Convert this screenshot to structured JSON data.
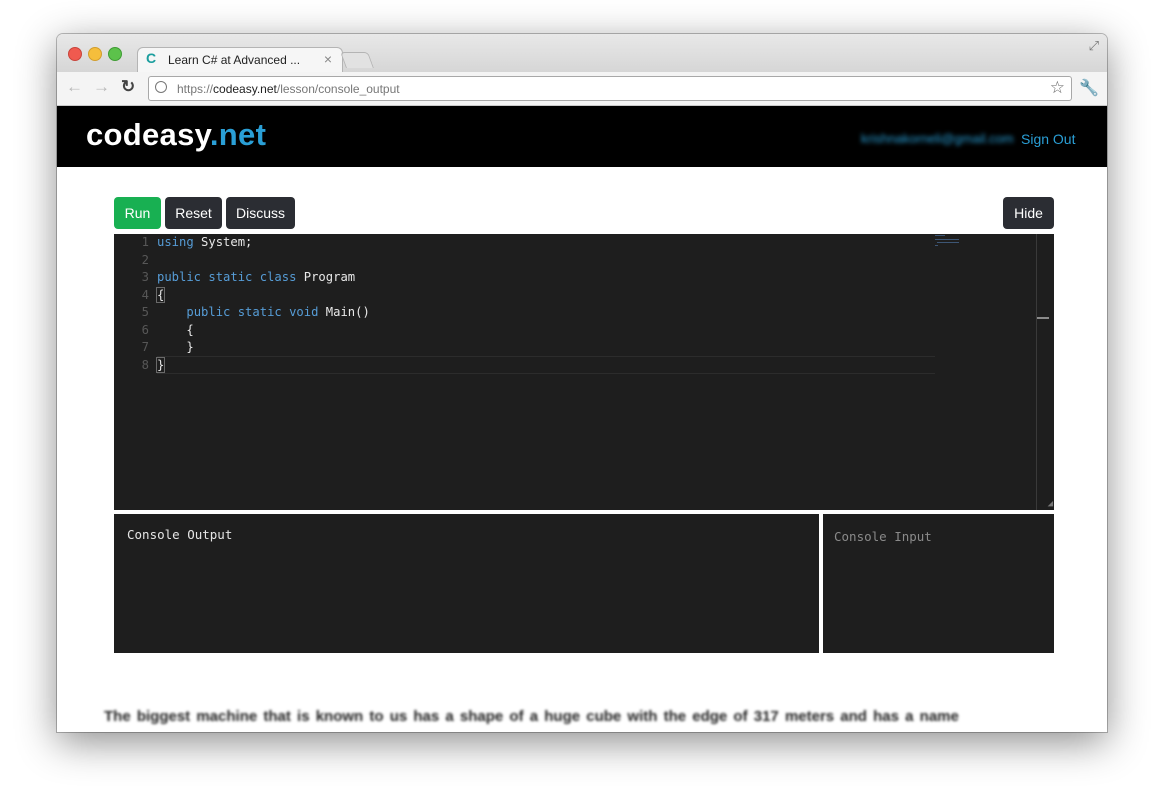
{
  "browser": {
    "tab_title": "Learn C# at Advanced ...",
    "tab_favicon": "C",
    "tab_close": "×",
    "url_scheme": "https://",
    "url_host": "codeasy.net",
    "url_path": "/lesson/console_output"
  },
  "site": {
    "logo_main": "codeasy",
    "logo_tld": ".net",
    "user_email": "krishnakorneli@gmail.com",
    "signout_label": "Sign Out"
  },
  "toolbar": {
    "run_label": "Run",
    "reset_label": "Reset",
    "discuss_label": "Discuss",
    "hide_label": "Hide"
  },
  "editor": {
    "line_numbers": [
      "1",
      "2",
      "3",
      "4",
      "5",
      "6",
      "7",
      "8"
    ],
    "line1": {
      "kw": "using",
      "rest": " System;"
    },
    "line3": {
      "kw": "public static class",
      "rest": " Program"
    },
    "line4": "{",
    "line5": {
      "indent": "    ",
      "kw": "public static void",
      "rest": " Main()"
    },
    "line6": "    {",
    "line7": "    }",
    "line8": "}"
  },
  "console": {
    "output_label": "Console Output",
    "input_placeholder": "Console Input"
  },
  "lesson": {
    "text": "The biggest machine that is known to us has a shape of a huge cube with the edge of 317 meters and has a name"
  },
  "colors": {
    "run_button": "#18b052",
    "dark_button": "#2b2d33",
    "link_blue": "#2a9fd6",
    "editor_bg": "#1e1e1e",
    "keyword": "#569cd6"
  },
  "icons": [
    "fullscreen-icon",
    "back-arrow-icon",
    "forward-arrow-icon",
    "reload-icon",
    "globe-icon",
    "star-icon",
    "wrench-icon",
    "resize-handle-icon"
  ]
}
